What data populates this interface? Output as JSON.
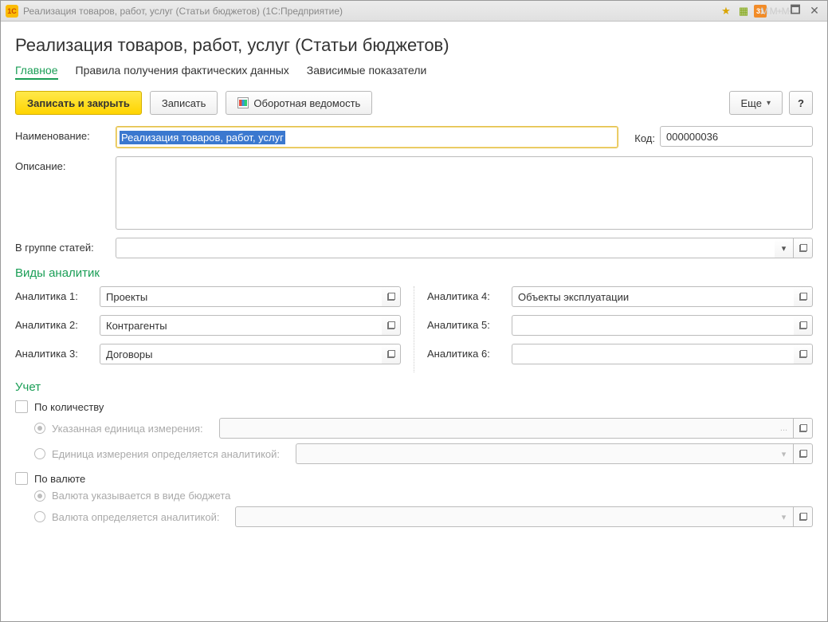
{
  "titlebar": {
    "title": "Реализация товаров, работ, услуг (Статьи бюджетов) (1С:Предприятие)",
    "calendar_text": "31"
  },
  "page": {
    "title": "Реализация товаров, работ, услуг (Статьи бюджетов)"
  },
  "tabs": {
    "main": "Главное",
    "rules": "Правила получения фактических данных",
    "dependent": "Зависимые показатели"
  },
  "toolbar": {
    "save_close": "Записать и закрыть",
    "save": "Записать",
    "turnover": "Оборотная ведомость",
    "more": "Еще",
    "help": "?"
  },
  "fields": {
    "name_label": "Наименование:",
    "name_value": "Реализация товаров, работ, услуг",
    "code_label": "Код:",
    "code_value": "000000036",
    "description_label": "Описание:",
    "description_value": "",
    "group_label": "В группе статей:",
    "group_value": ""
  },
  "analytics": {
    "section": "Виды аналитик",
    "labels": {
      "a1": "Аналитика 1:",
      "a2": "Аналитика 2:",
      "a3": "Аналитика 3:",
      "a4": "Аналитика 4:",
      "a5": "Аналитика 5:",
      "a6": "Аналитика 6:"
    },
    "values": {
      "a1": "Проекты",
      "a2": "Контрагенты",
      "a3": "Договоры",
      "a4": "Объекты эксплуатации",
      "a5": "",
      "a6": ""
    }
  },
  "accounting": {
    "section": "Учет",
    "by_quantity": "По количеству",
    "unit_specified": "Указанная единица измерения:",
    "unit_by_analytic": "Единица измерения определяется аналитикой:",
    "by_currency": "По валюте",
    "currency_in_budget": "Валюта указывается в виде бюджета",
    "currency_by_analytic": "Валюта определяется аналитикой:",
    "ellipsis": "..."
  }
}
